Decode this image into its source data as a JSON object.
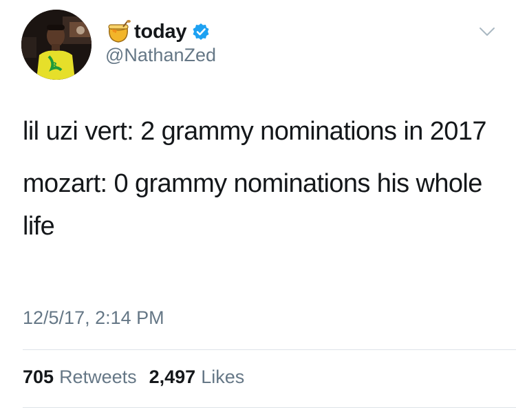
{
  "author": {
    "display_name": "today",
    "handle": "@NathanZed",
    "verified": true,
    "name_emoji": "honey-pot-icon"
  },
  "tweet": {
    "paragraphs": [
      "lil uzi vert: 2 grammy nominations in 2017",
      "mozart: 0 grammy nominations his whole life"
    ],
    "timestamp": "12/5/17, 2:14 PM"
  },
  "stats": {
    "retweets_count": "705",
    "retweets_label": "Retweets",
    "likes_count": "2,497",
    "likes_label": "Likes"
  },
  "colors": {
    "text_primary": "#14171a",
    "text_secondary": "#657786",
    "verified_blue": "#1da1f2",
    "divider": "#dde3e8",
    "shirt_yellow": "#e8e02a"
  },
  "icons": {
    "menu": "chevron-down-icon",
    "verified": "verified-badge-icon"
  }
}
